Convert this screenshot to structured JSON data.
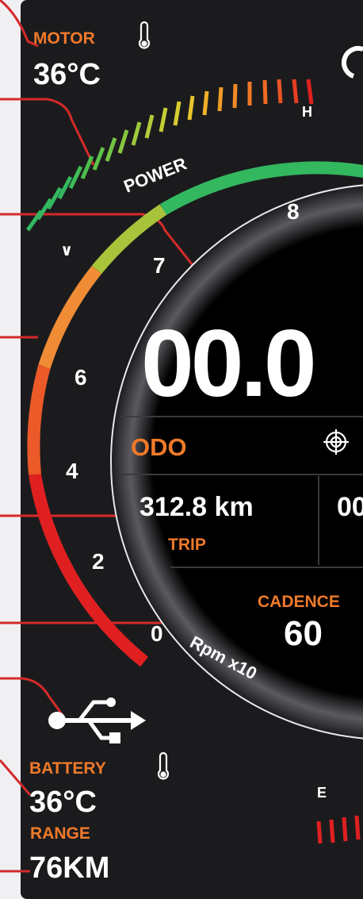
{
  "motor": {
    "label": "MOTOR",
    "temperature": "36°C"
  },
  "power": {
    "label": "POWER",
    "high_label": "H",
    "low_label": "∨"
  },
  "speed": {
    "value": "00.0"
  },
  "scale": {
    "unit_label": "Rpm x10",
    "ticks": [
      "0",
      "2",
      "4",
      "6",
      "7",
      "8"
    ]
  },
  "odometer": {
    "label": "ODO"
  },
  "trip": {
    "value": "312.8 km",
    "label": "TRIP",
    "secondary_value": "00"
  },
  "cadence": {
    "label": "CADENCE",
    "value": "60"
  },
  "battery": {
    "label": "BATTERY",
    "temperature": "36°C"
  },
  "range": {
    "label": "RANGE",
    "value": "76KM"
  },
  "fuel_gauge": {
    "empty_label": "E"
  },
  "icons": [
    "thermometer-icon",
    "usb-icon",
    "target-icon"
  ],
  "colors": {
    "accent_orange": "#f07a2a",
    "gauge_red": "#e02020",
    "gauge_green": "#33b860",
    "panel": "#1b1b1e"
  }
}
